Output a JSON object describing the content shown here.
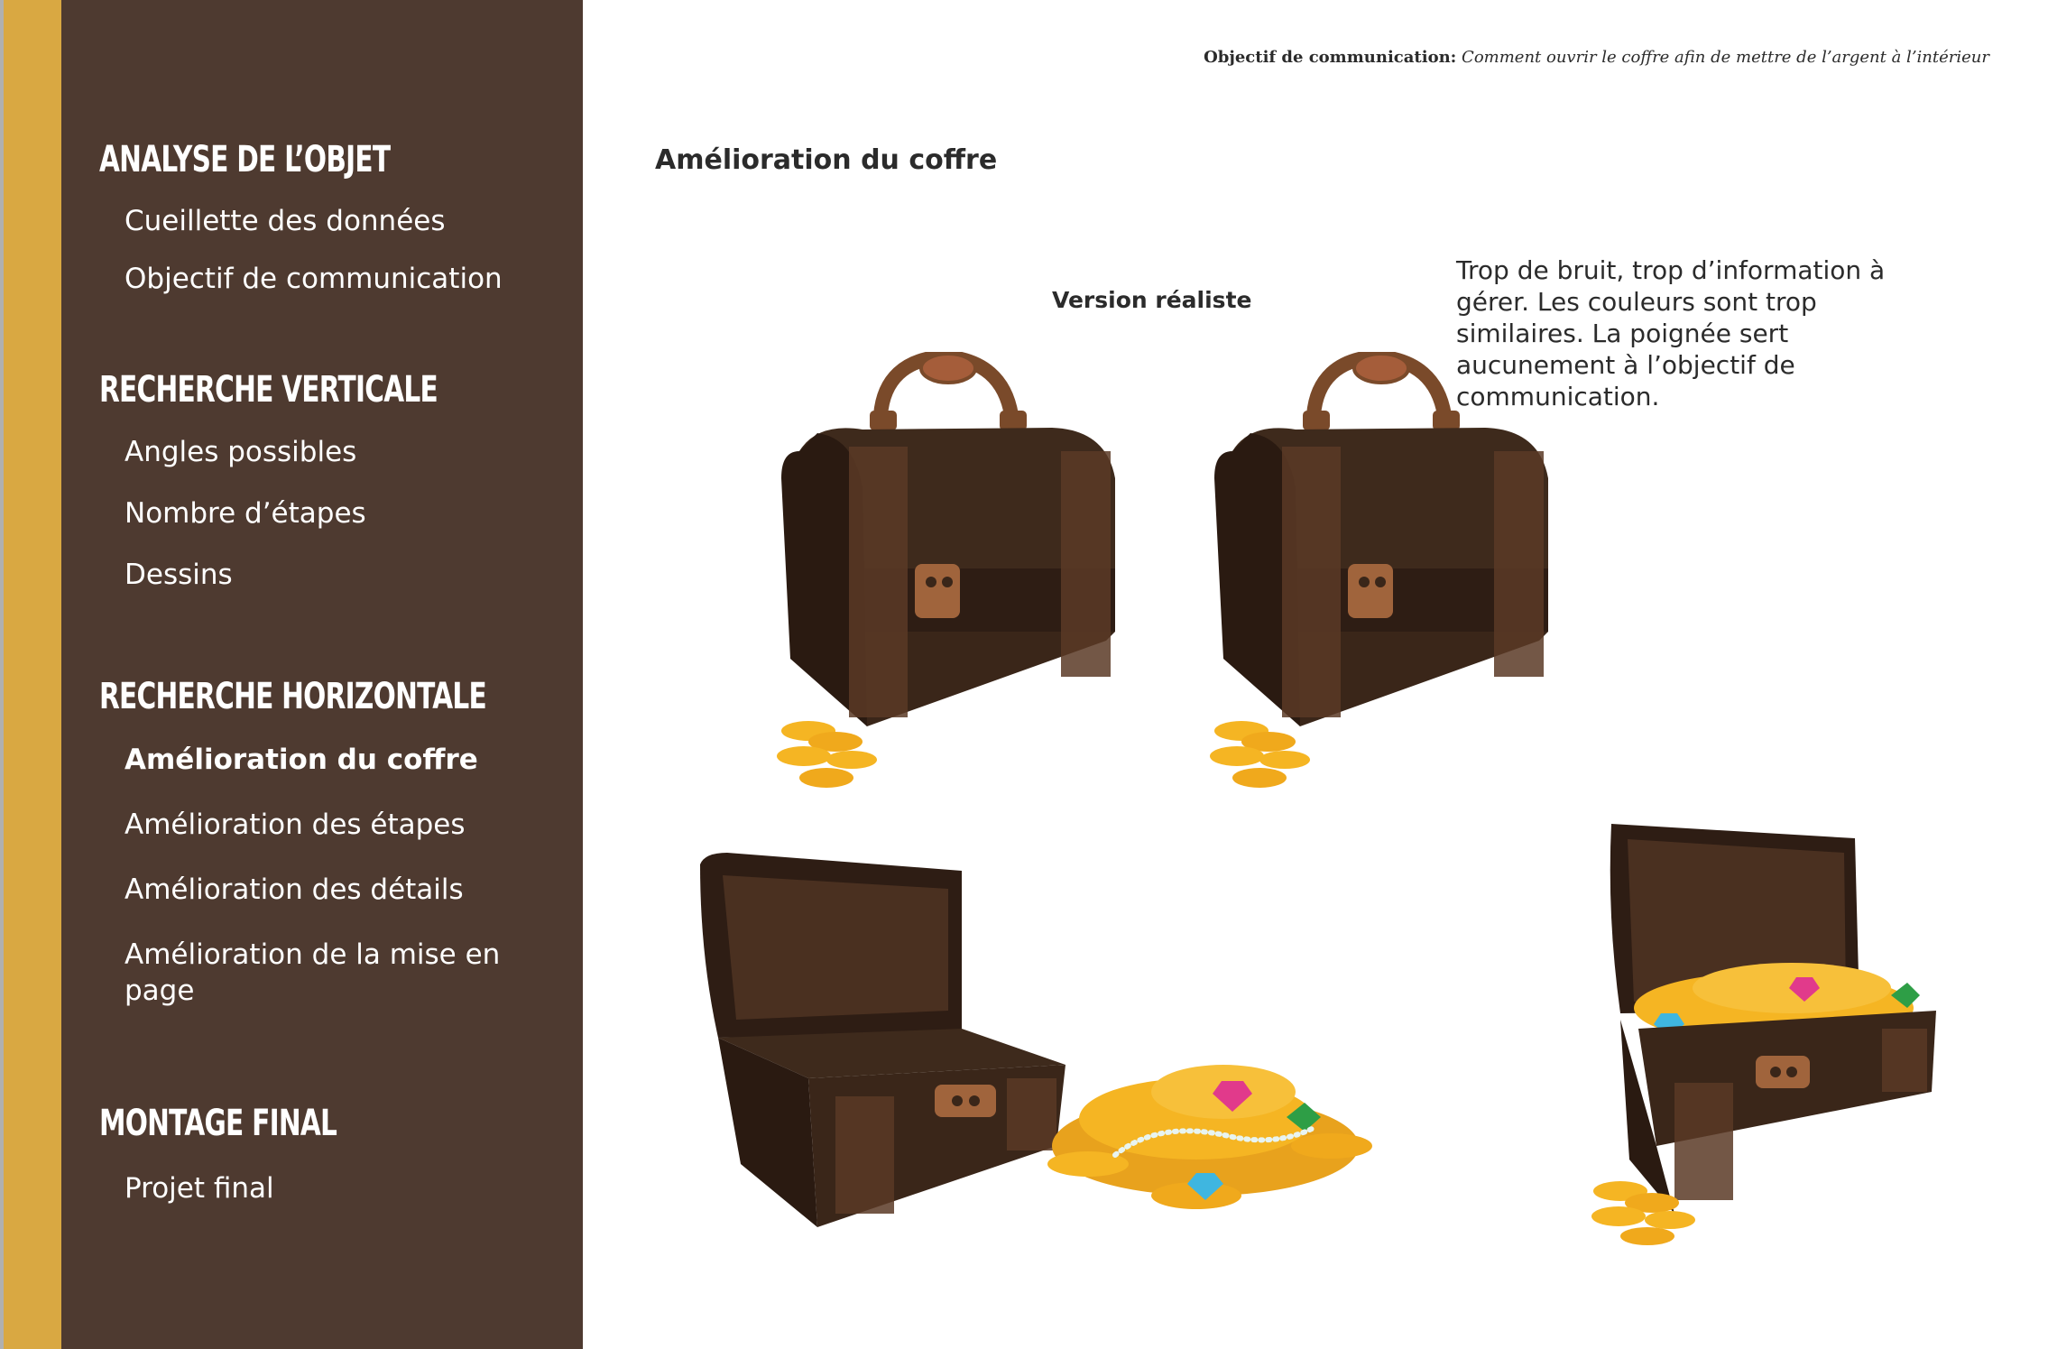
{
  "sidebar": {
    "sections": [
      {
        "title": "ANALYSE DE L’OBJET",
        "items": [
          "Cueillette des données",
          "Objectif de communication"
        ]
      },
      {
        "title": "RECHERCHE VERTICALE",
        "items": [
          "Angles possibles",
          "Nombre d’étapes",
          "Dessins"
        ]
      },
      {
        "title": "RECHERCHE HORIZONTALE",
        "items": [
          "Amélioration du coffre",
          "Amélioration des étapes",
          "Amélioration des détails",
          "Amélioration de la mise en page"
        ]
      },
      {
        "title": "MONTAGE FINAL",
        "items": [
          "Projet final"
        ]
      }
    ],
    "active_item": "Amélioration du coffre"
  },
  "header": {
    "label": "Objectif de communication:",
    "value": "Comment ouvrir le coffre afin de mettre de l’argent à l’intérieur"
  },
  "main": {
    "title": "Amélioration du  coffre",
    "version_label": "Version réaliste",
    "comment": "Trop de bruit, trop d’information à gérer. Les couleurs sont trop similaires. La poignée sert aucunement à l’objectif de communication."
  },
  "colors": {
    "sidebar_bg": "#4e3a30",
    "accent_gold": "#d9a842",
    "chest_dark": "#2e1d14",
    "chest_mid": "#4a3020",
    "handle": "#7a4a2a",
    "coin": "#f5b523"
  },
  "images": [
    {
      "name": "closed-chest-with-coins"
    },
    {
      "name": "closed-chest-with-coins"
    },
    {
      "name": "open-empty-chest-with-treasure-pile"
    },
    {
      "name": "open-full-chest-with-coins"
    }
  ]
}
